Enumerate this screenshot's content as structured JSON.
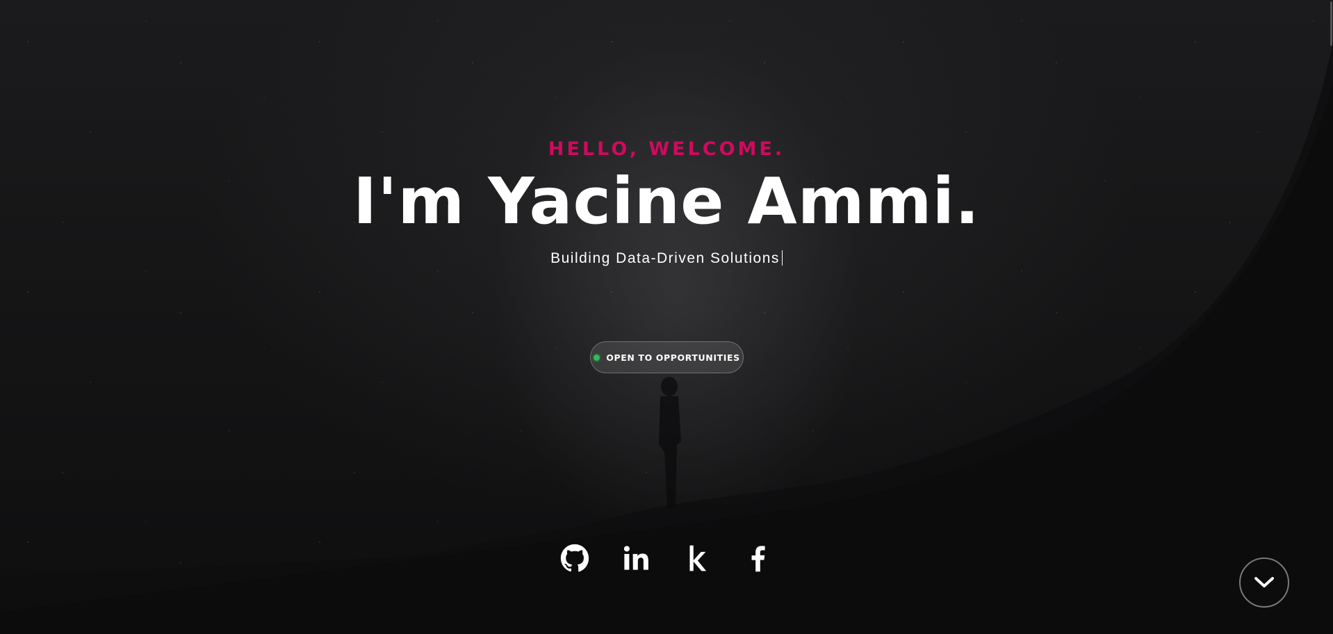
{
  "hero": {
    "greeting": "HELLO, WELCOME.",
    "headline": "I'm Yacine Ammi.",
    "tagline": "Building Data-Driven Solutions"
  },
  "status": {
    "label": "OPEN TO OPPORTUNITIES",
    "dot_color": "#2ebd59"
  },
  "socials": [
    {
      "icon": "github-icon"
    },
    {
      "icon": "linkedin-icon"
    },
    {
      "icon": "kaggle-icon"
    },
    {
      "icon": "facebook-icon"
    }
  ],
  "scroll_down": {
    "icon": "chevron-down-icon"
  },
  "colors": {
    "accent": "#d1095e",
    "background": "#0f0f10",
    "text": "#ffffff"
  }
}
